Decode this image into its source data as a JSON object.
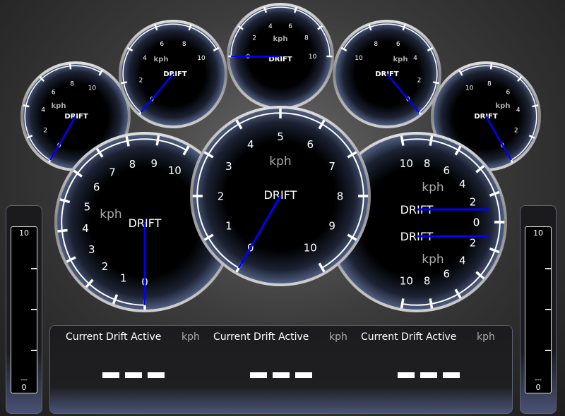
{
  "colors": {
    "needle": "#0000ff",
    "rim": "#4a5878",
    "text": "#ffffff",
    "unit_text": "#aaaaaa"
  },
  "gauges": [
    {
      "id": "small-left",
      "title": "DRIFT",
      "unit": "kph",
      "scale": [
        "0",
        "2",
        "4",
        "6",
        "8",
        "10"
      ],
      "values": [
        0
      ]
    },
    {
      "id": "small-right",
      "title": "DRIFT",
      "unit": "kph",
      "scale": [
        "0",
        "2",
        "4",
        "6",
        "8",
        "10"
      ],
      "values": [
        0
      ]
    },
    {
      "id": "top-left",
      "title": "DRIFT",
      "unit": "kph",
      "scale": [
        "0",
        "2",
        "4",
        "6",
        "8",
        "10"
      ],
      "values": [
        0
      ]
    },
    {
      "id": "top-right",
      "title": "DRIFT",
      "unit": "kph",
      "scale": [
        "0",
        "2",
        "4",
        "6",
        "8",
        "10"
      ],
      "values": [
        0
      ]
    },
    {
      "id": "top-center",
      "title": "DRIFT",
      "unit": "kph",
      "scale": [
        "0",
        "2",
        "4",
        "6",
        "8",
        "10"
      ],
      "values": [
        0
      ]
    },
    {
      "id": "big-left",
      "title": "DRIFT",
      "unit": "kph",
      "scale": [
        "0",
        "1",
        "2",
        "3",
        "4",
        "5",
        "6",
        "7",
        "8",
        "9",
        "10"
      ],
      "values": [
        0
      ]
    },
    {
      "id": "big-right",
      "title": "DRIFT",
      "unit": "kph",
      "scale": [
        "0",
        "2",
        "4",
        "6",
        "8",
        "10"
      ],
      "values": [
        0,
        0
      ]
    },
    {
      "id": "big-center",
      "title": "DRIFT",
      "unit": "kph",
      "scale": [
        "0",
        "1",
        "2",
        "3",
        "4",
        "5",
        "6",
        "7",
        "8",
        "9",
        "10"
      ],
      "values": [
        0
      ]
    }
  ],
  "bars": {
    "left": {
      "max": "10",
      "min": "0",
      "value": "---",
      "level": 0
    },
    "right": {
      "max": "10",
      "min": "0",
      "value": "---",
      "level": 0
    }
  },
  "readouts": [
    {
      "title": "Current Drift Active",
      "unit": "kph",
      "value": "---"
    },
    {
      "title": "Current Drift Active",
      "unit": "kph",
      "value": "---"
    },
    {
      "title": "Current Drift Active",
      "unit": "kph",
      "value": "---"
    }
  ]
}
